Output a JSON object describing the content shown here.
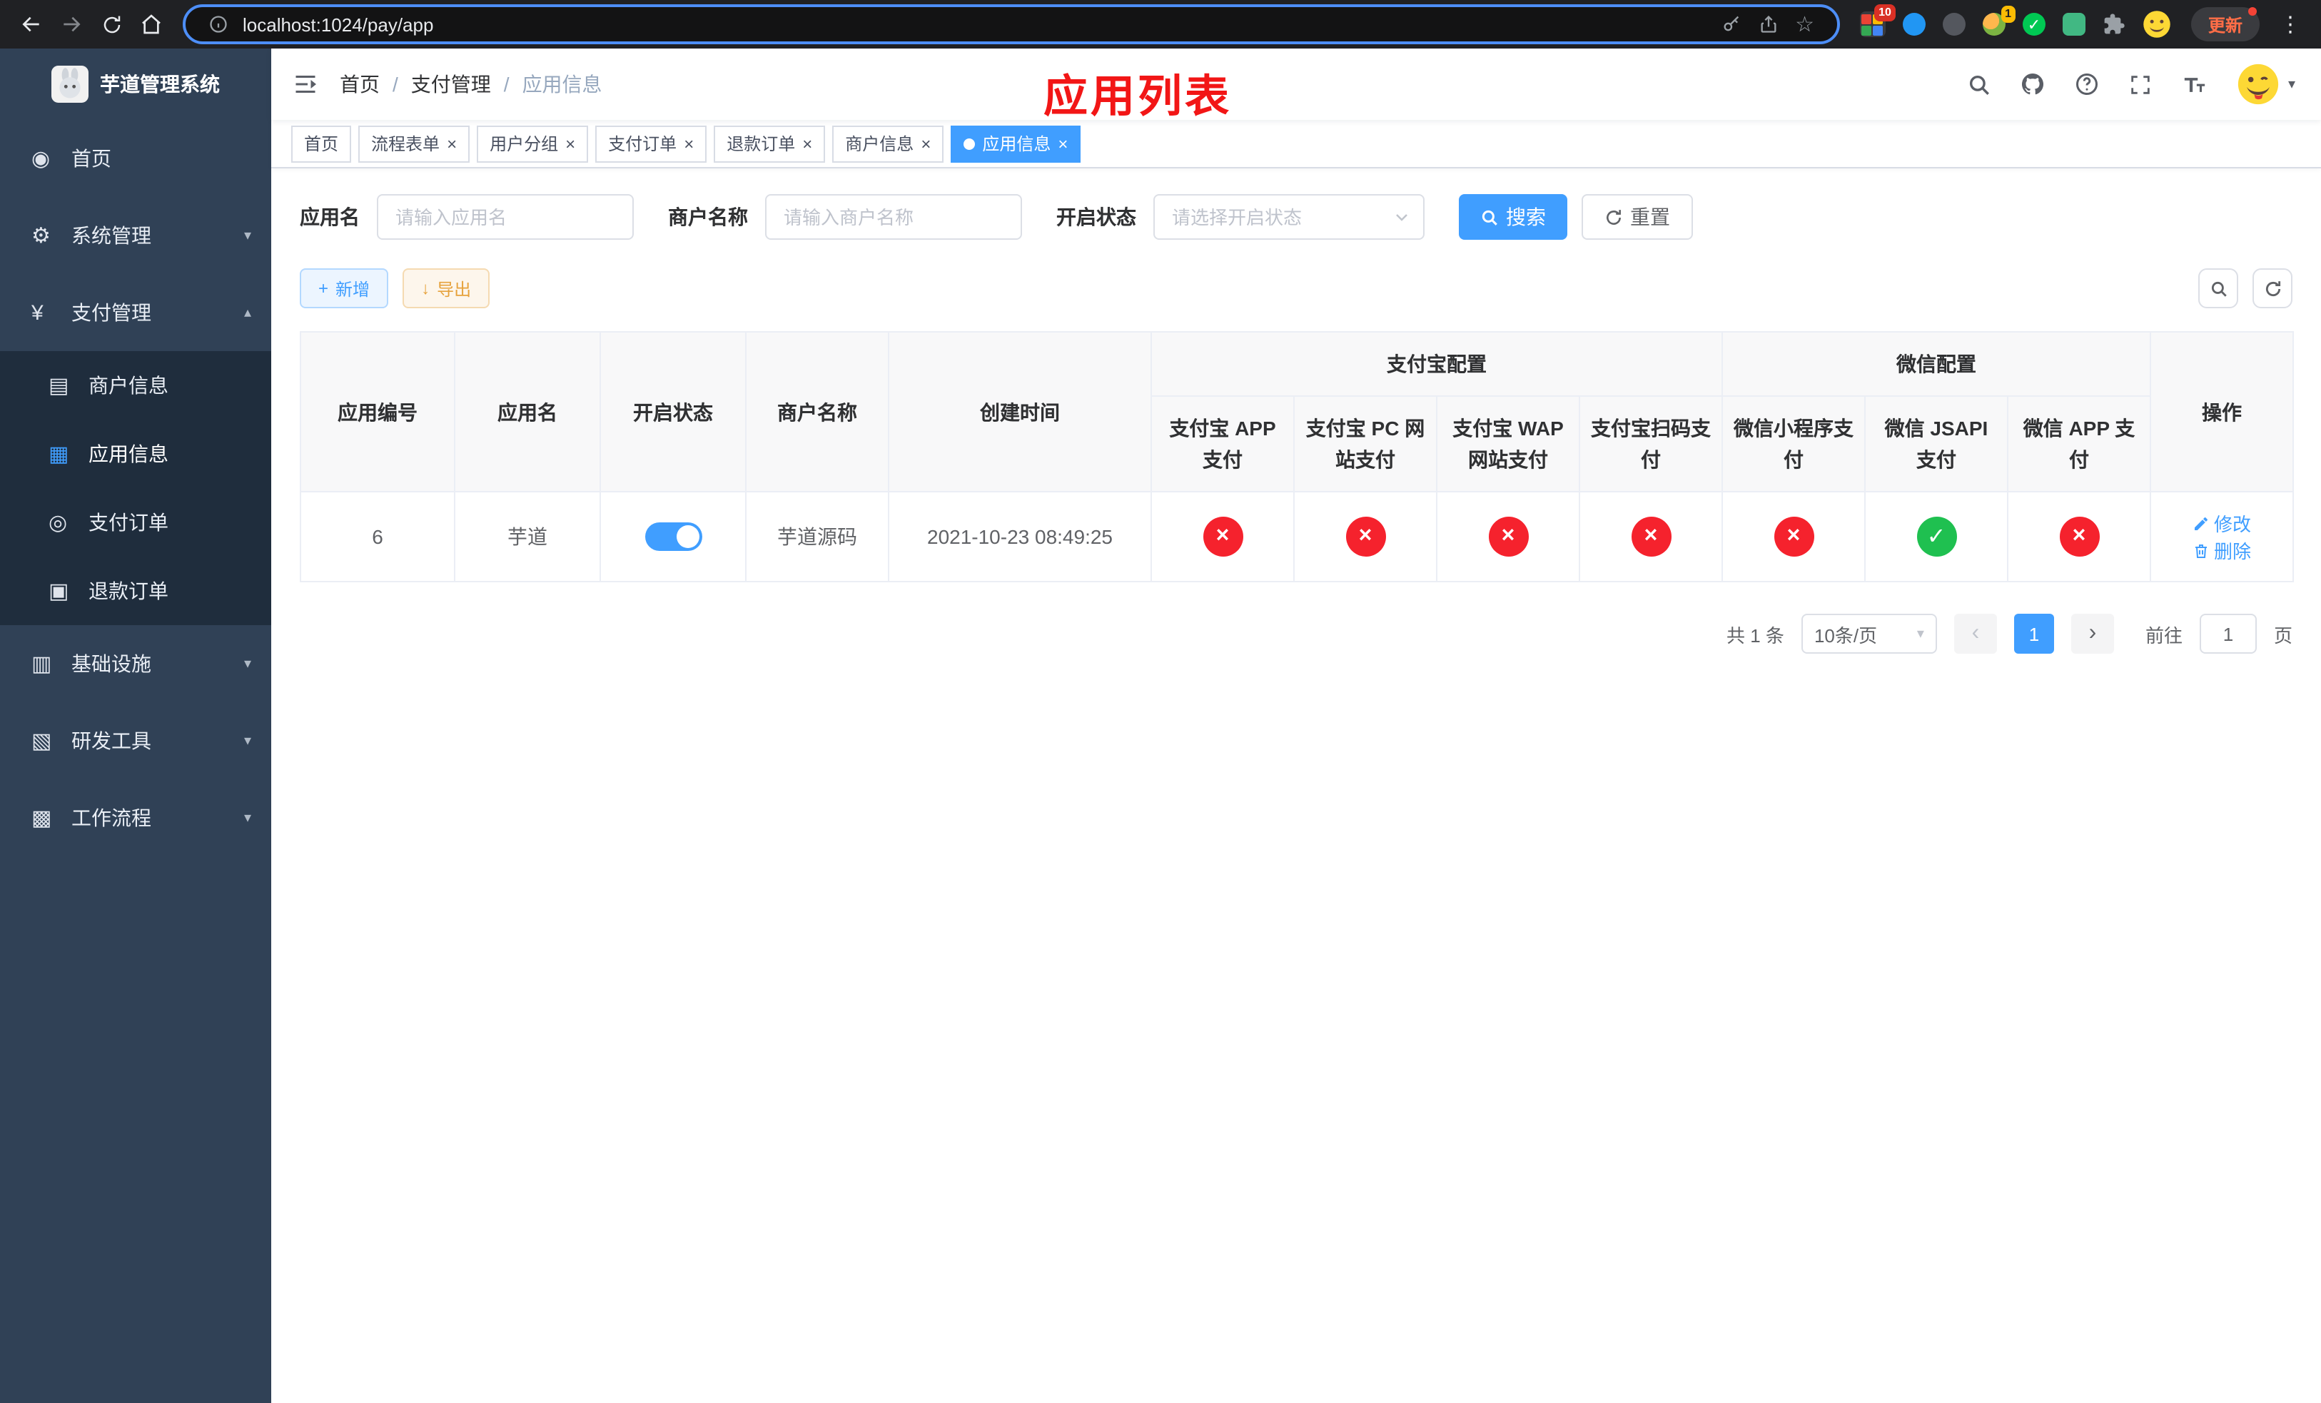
{
  "theme": {
    "primary": "#409eff",
    "sidebar_bg": "#304156",
    "submenu_bg": "#1f2d3d",
    "danger_circle": "#f5222d",
    "success_circle": "#1fc050",
    "warning": "#e6a23c",
    "annotation_red": "#f21616"
  },
  "browser": {
    "url": "localhost:1024/pay/app",
    "update_label": "更新",
    "ext_badge_grid": "10",
    "ext_badge_avatar": "1"
  },
  "icons": {
    "home": "◉",
    "system": "⚙",
    "payment": "¥",
    "merchant": "▤",
    "app": "▦",
    "order": "◎",
    "refund": "▣",
    "infra": "▥",
    "devtool": "▧",
    "workflow": "▩",
    "chevron_down": "▾",
    "chevron_up": "▴",
    "close": "×",
    "no": "×",
    "yes": "✓",
    "prev": "‹",
    "next": "›",
    "kebab": "⋮",
    "star": "☆",
    "slash": "/",
    "plus": "+",
    "download": "↓",
    "caret": "▾"
  },
  "sidebar": {
    "title": "芋道管理系统",
    "menu_home": "首页",
    "menu_system": "系统管理",
    "menu_payment": "支付管理",
    "sub_merchant": "商户信息",
    "sub_app": "应用信息",
    "sub_order": "支付订单",
    "sub_refund": "退款订单",
    "menu_infra": "基础设施",
    "menu_devtool": "研发工具",
    "menu_workflow": "工作流程"
  },
  "navbar": {
    "breadcrumb": [
      "首页",
      "支付管理",
      "应用信息"
    ]
  },
  "annotation": "应用列表",
  "tabs": [
    {
      "label": "首页"
    },
    {
      "label": "流程表单"
    },
    {
      "label": "用户分组"
    },
    {
      "label": "支付订单"
    },
    {
      "label": "退款订单"
    },
    {
      "label": "商户信息"
    },
    {
      "label": "应用信息"
    }
  ],
  "filters": {
    "app_name_label": "应用名",
    "app_name_placeholder": "请输入应用名",
    "merchant_label": "商户名称",
    "merchant_placeholder": "请输入商户名称",
    "status_label": "开启状态",
    "status_placeholder": "请选择开启状态",
    "search": "搜索",
    "reset": "重置"
  },
  "toolbar": {
    "add": "新增",
    "export": "导出"
  },
  "table": {
    "headers": {
      "app_id": "应用编号",
      "app_name": "应用名",
      "status": "开启状态",
      "merchant_name": "商户名称",
      "create_time": "创建时间",
      "alipay_group": "支付宝配置",
      "wechat_group": "微信配置",
      "alipay_app": "支付宝 APP 支付",
      "alipay_pc": "支付宝 PC 网站支付",
      "alipay_wap": "支付宝 WAP 网站支付",
      "alipay_qr": "支付宝扫码支付",
      "wx_mini": "微信小程序支付",
      "wx_jsapi": "微信 JSAPI 支付",
      "wx_app": "微信 APP 支付",
      "actions": "操作"
    },
    "row": {
      "app_id": "6",
      "app_name": "芋道",
      "status_on": true,
      "merchant_name": "芋道源码",
      "create_time": "2021-10-23 08:49:25",
      "alipay_app": "no",
      "alipay_pc": "no",
      "alipay_wap": "no",
      "alipay_qr": "no",
      "wx_mini": "no",
      "wx_jsapi": "yes",
      "wx_app": "no",
      "edit": "修改",
      "delete": "删除"
    }
  },
  "pagination": {
    "total": "共 1 条",
    "page_size": "10条/页",
    "page": "1",
    "goto": "前往",
    "unit": "页",
    "goto_value": "1"
  }
}
